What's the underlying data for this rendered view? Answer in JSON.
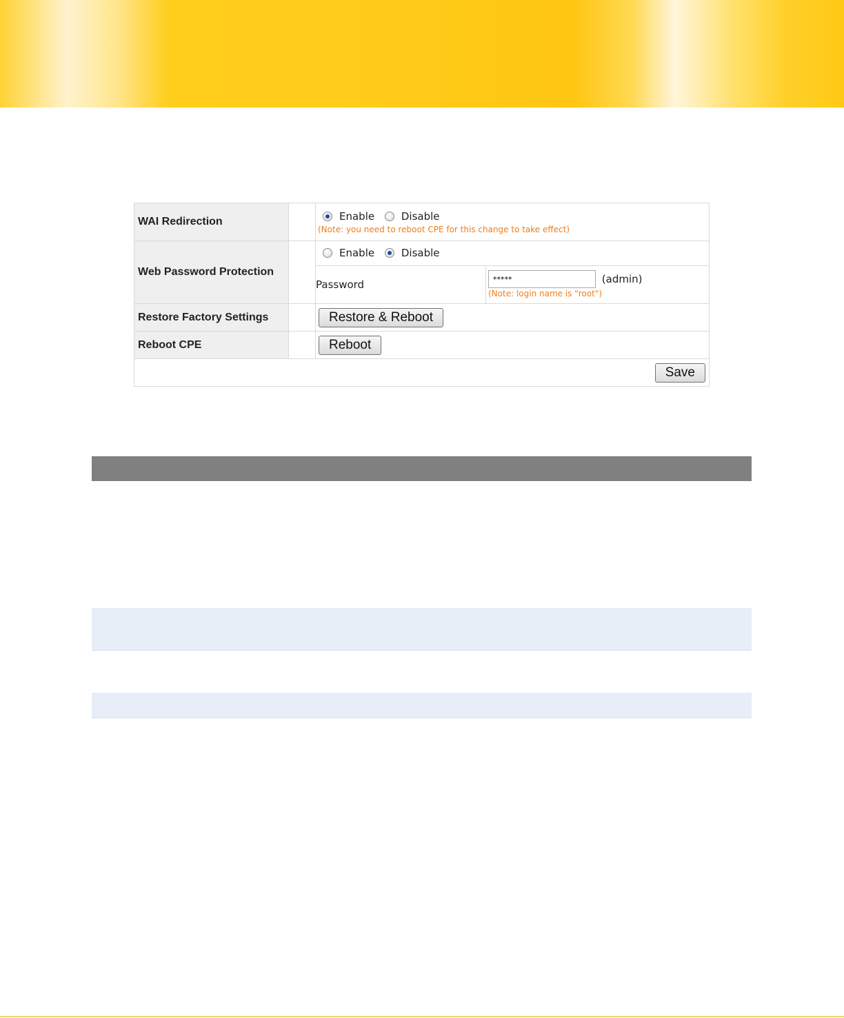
{
  "settings": {
    "wai_redirection": {
      "label": "WAI Redirection",
      "enable_label": "Enable",
      "disable_label": "Disable",
      "selected": "Enable",
      "note": "(Note: you need to reboot CPE for this change to take effect)"
    },
    "web_password": {
      "label": "Web Password Protection",
      "enable_label": "Enable",
      "disable_label": "Disable",
      "selected": "Disable",
      "password_label": "Password",
      "password_value": "*****",
      "password_hint": "(admin)",
      "note": "(Note: login name is \"root\")"
    },
    "restore": {
      "label": "Restore Factory Settings",
      "button_label": "Restore & Reboot"
    },
    "reboot": {
      "label": "Reboot CPE",
      "button_label": "Reboot"
    },
    "save_label": "Save"
  },
  "colors": {
    "banner": "#ffcb18",
    "note": "#f07d1a",
    "label_bg": "#efefef",
    "gray_bar": "#808080",
    "blue_band": "#e7eef8"
  }
}
